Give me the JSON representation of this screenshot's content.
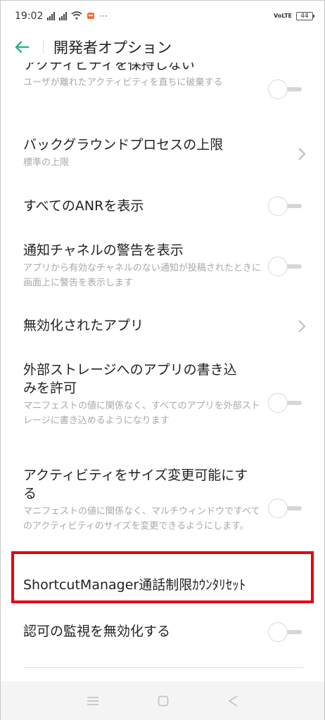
{
  "status": {
    "time": "19:02",
    "battery": "44",
    "volte": "VoLTE"
  },
  "header": {
    "title": "開発者オプション"
  },
  "settings": [
    {
      "title": "アクティビティを保持しない",
      "subtitle": "ユーザが離れたアクティビティを直ちに破棄する",
      "control": "toggle",
      "on": false
    },
    {
      "title": "バックグラウンドプロセスの上限",
      "subtitle": "標準の上限",
      "control": "chevron"
    },
    {
      "title": "すべてのANRを表示",
      "subtitle": "",
      "control": "toggle",
      "on": false
    },
    {
      "title": "通知チャネルの警告を表示",
      "subtitle": "アプリから有効なチャネルのない通知が投稿されたときに画面上に警告を表示します",
      "control": "toggle",
      "on": false
    },
    {
      "title": "無効化されたアプリ",
      "subtitle": "",
      "control": "chevron"
    },
    {
      "title": "外部ストレージへのアプリの書き込みを許可",
      "subtitle": "マニフェストの値に関係なく、すべてのアプリを外部ストレージに書き込めるようになります",
      "control": "toggle",
      "on": false
    },
    {
      "title": "アクティビティをサイズ変更可能にする",
      "subtitle": "マニフェストの値に関係なく、マルチウィンドウですべてのアクティビティのサイズを変更できるようにします。",
      "control": "toggle",
      "on": false
    },
    {
      "title": "ShortcutManager通話制限ｶｳﾝﾀﾘｾｯﾄ",
      "subtitle": "",
      "control": "none"
    },
    {
      "title": "認可の監視を無効化する",
      "subtitle": "",
      "control": "toggle",
      "on": false,
      "highlighted": true
    }
  ],
  "colors": {
    "accent": "#2db87d",
    "highlight_border": "#e60012"
  },
  "icons": {
    "back": "arrow-left-icon",
    "chevron": "chevron-right-icon",
    "nav_menu": "menu-icon",
    "nav_home": "home-icon",
    "nav_back": "back-triangle-icon"
  }
}
